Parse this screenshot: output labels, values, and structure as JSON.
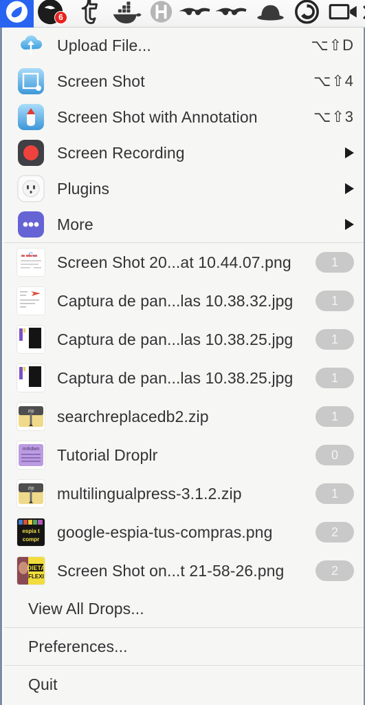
{
  "menubar": {
    "app_badge_count": "6",
    "icons": [
      {
        "name": "droplr-leaf-icon",
        "active": true
      },
      {
        "name": "notification-bell-icon",
        "active": false
      },
      {
        "name": "tumblr-icon",
        "active": false
      },
      {
        "name": "docker-whale-icon",
        "active": false
      },
      {
        "name": "h-circle-icon",
        "active": false
      },
      {
        "name": "sunglasses-icon",
        "active": false
      },
      {
        "name": "sunglasses-alt-icon",
        "active": false
      },
      {
        "name": "bowler-hat-icon",
        "active": false
      },
      {
        "name": "sync-circle-icon",
        "active": false
      },
      {
        "name": "video-camera-icon",
        "active": false
      }
    ]
  },
  "actions": [
    {
      "label": "Upload File...",
      "shortcut": "⌥⇧D",
      "icon": "cloud-upload-icon",
      "submenu": false
    },
    {
      "label": "Screen Shot",
      "shortcut": "⌥⇧4",
      "icon": "screenshot-icon",
      "submenu": false
    },
    {
      "label": "Screen Shot with Annotation",
      "shortcut": "⌥⇧3",
      "icon": "annotation-pen-icon",
      "submenu": false
    },
    {
      "label": "Screen Recording",
      "shortcut": "",
      "icon": "screen-recording-icon",
      "submenu": true
    },
    {
      "label": "Plugins",
      "shortcut": "",
      "icon": "plugins-outlet-icon",
      "submenu": true
    },
    {
      "label": "More",
      "shortcut": "",
      "icon": "more-ellipsis-icon",
      "submenu": true
    }
  ],
  "drops": [
    {
      "name": "Screen Shot 20...at 10.44.07.png",
      "count": "1",
      "thumb": "google-doc-thumb"
    },
    {
      "name": "Captura de pan...las 10.38.32.jpg",
      "count": "1",
      "thumb": "annotated-doc-thumb"
    },
    {
      "name": "Captura de pan...las 10.38.25.jpg",
      "count": "1",
      "thumb": "dark-panel-thumb"
    },
    {
      "name": "Captura de pan...las 10.38.25.jpg",
      "count": "1",
      "thumb": "dark-panel-thumb"
    },
    {
      "name": "searchreplacedb2.zip",
      "count": "1",
      "thumb": "zip-thumb"
    },
    {
      "name": "Tutorial Droplr",
      "count": "0",
      "thumb": "markdown-thumb"
    },
    {
      "name": "multilingualpress-3.1.2.zip",
      "count": "1",
      "thumb": "zip-thumb"
    },
    {
      "name": "google-espia-tus-compras.png",
      "count": "2",
      "thumb": "espia-thumb"
    },
    {
      "name": "Screen Shot on...t 21-58-26.png",
      "count": "2",
      "thumb": "dieta-thumb"
    }
  ],
  "footer": {
    "view_all": "View All Drops...",
    "preferences": "Preferences...",
    "quit": "Quit"
  },
  "colors": {
    "accent": "#2864f0",
    "badge_red": "#e8221f",
    "count_badge": "#c9c9c9",
    "panel_bg": "#f6f6f4",
    "text": "#333336"
  }
}
